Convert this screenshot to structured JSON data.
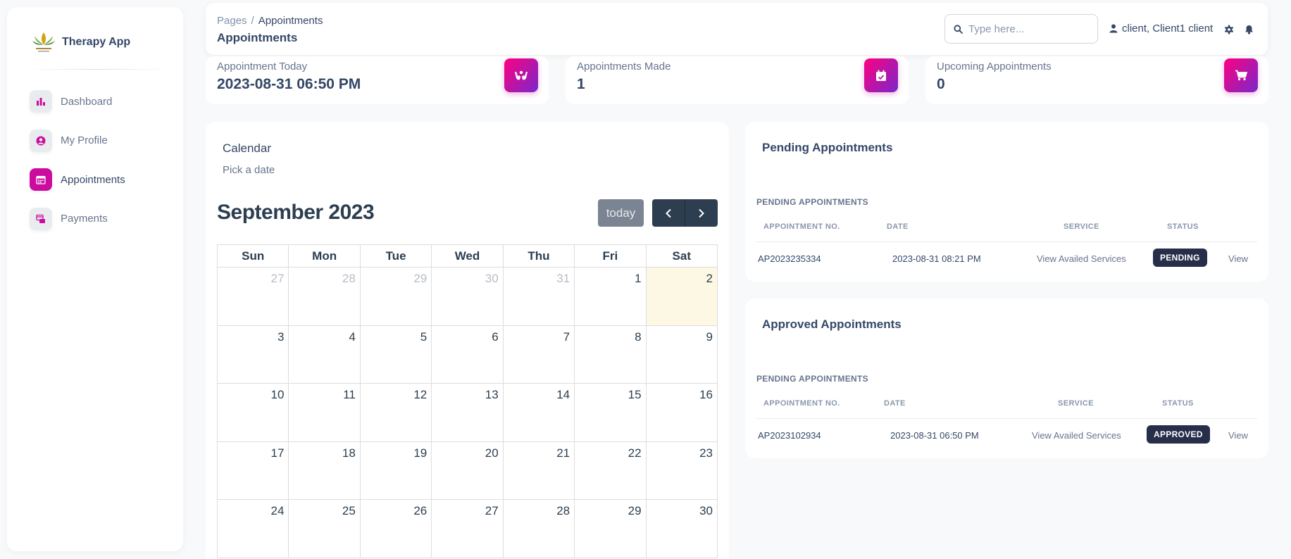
{
  "sidebar": {
    "brand": "Therapy App",
    "items": [
      {
        "label": "Dashboard"
      },
      {
        "label": "My Profile"
      },
      {
        "label": "Appointments"
      },
      {
        "label": "Payments"
      }
    ]
  },
  "header": {
    "breadcrumb_root": "Pages",
    "breadcrumb_sep": "/",
    "breadcrumb_current": "Appointments",
    "title": "Appointments",
    "search_placeholder": "Type here...",
    "user_name": "client, Client1 client"
  },
  "stats": [
    {
      "label": "Appointment Today",
      "value": "2023-08-31 06:50 PM",
      "icon": "hands-icon"
    },
    {
      "label": "Appointments Made",
      "value": "1",
      "icon": "calendar-check-icon"
    },
    {
      "label": "Upcoming Appointments",
      "value": "0",
      "icon": "cart-icon"
    }
  ],
  "calendar": {
    "title": "Calendar",
    "subtitle": "Pick a date",
    "month": "September 2023",
    "today_label": "today",
    "weekdays": [
      "Sun",
      "Mon",
      "Tue",
      "Wed",
      "Thu",
      "Fri",
      "Sat"
    ],
    "weeks": [
      [
        "27",
        "28",
        "29",
        "30",
        "31",
        "1",
        "2"
      ],
      [
        "3",
        "4",
        "5",
        "6",
        "7",
        "8",
        "9"
      ],
      [
        "10",
        "11",
        "12",
        "13",
        "14",
        "15",
        "16"
      ],
      [
        "17",
        "18",
        "19",
        "20",
        "21",
        "22",
        "23"
      ],
      [
        "24",
        "25",
        "26",
        "27",
        "28",
        "29",
        "30"
      ]
    ]
  },
  "pending": {
    "title": "Pending Appointments",
    "section": "PENDING APPOINTMENTS",
    "columns": [
      "APPOINTMENT NO.",
      "DATE",
      "SERVICE",
      "STATUS"
    ],
    "row": {
      "number": "AP2023235334",
      "date": "2023-08-31 08:21 PM",
      "service": "View Availed Services",
      "status": "PENDING",
      "action": "View"
    }
  },
  "approved": {
    "title": "Approved Appointments",
    "section": "PENDING APPOINTMENTS",
    "columns": [
      "APPOINTMENT NO.",
      "DATE",
      "SERVICE",
      "STATUS"
    ],
    "row": {
      "number": "AP2023102934",
      "date": "2023-08-31 06:50 PM",
      "service": "View Availed Services",
      "status": "APPROVED",
      "action": "View"
    }
  },
  "colors": {
    "accent": "#cb0c9f",
    "text": "#344767",
    "badge": "#262e49",
    "today_cell": "#fcf8e3"
  }
}
